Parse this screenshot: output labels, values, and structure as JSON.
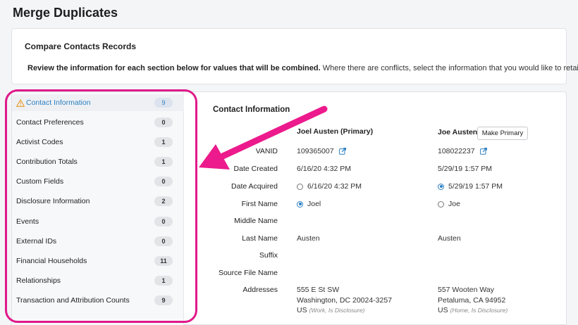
{
  "page": {
    "title": "Merge Duplicates"
  },
  "compare": {
    "title": "Compare Contacts Records",
    "desc_bold": "Review the information for each section below for values that will be combined.",
    "desc_rest": " Where there are conflicts, select the information that you would like to retain."
  },
  "sidebar": {
    "items": [
      {
        "label": "Contact Information",
        "count": "9"
      },
      {
        "label": "Contact Preferences",
        "count": "0"
      },
      {
        "label": "Activist Codes",
        "count": "1"
      },
      {
        "label": "Contribution Totals",
        "count": "1"
      },
      {
        "label": "Custom Fields",
        "count": "0"
      },
      {
        "label": "Disclosure Information",
        "count": "2"
      },
      {
        "label": "Events",
        "count": "0"
      },
      {
        "label": "External IDs",
        "count": "0"
      },
      {
        "label": "Financial Households",
        "count": "11"
      },
      {
        "label": "Relationships",
        "count": "1"
      },
      {
        "label": "Transaction and Attribution Counts",
        "count": "9"
      }
    ],
    "active_icon": "warning-triangle-icon"
  },
  "section": {
    "title": "Contact Information",
    "primary_name": "Joel Austen (Primary)",
    "secondary_name": "Joe Austen",
    "make_primary_label": "Make Primary"
  },
  "fields": {
    "vanid": {
      "label": "VANID",
      "primary": "109365007",
      "secondary": "108022237"
    },
    "date_created": {
      "label": "Date Created",
      "primary": "6/16/20 4:32 PM",
      "secondary": "5/29/19 1:57 PM"
    },
    "date_acquired": {
      "label": "Date Acquired",
      "primary": "6/16/20 4:32 PM",
      "secondary": "5/29/19 1:57 PM",
      "selected": "secondary"
    },
    "first_name": {
      "label": "First Name",
      "primary": "Joel",
      "secondary": "Joe",
      "selected": "primary"
    },
    "middle_name": {
      "label": "Middle Name"
    },
    "last_name": {
      "label": "Last Name",
      "primary": "Austen",
      "secondary": "Austen"
    },
    "suffix": {
      "label": "Suffix"
    },
    "source_file_name": {
      "label": "Source File Name"
    },
    "addresses": {
      "label": "Addresses",
      "primary": {
        "line1": "555 E St SW",
        "line2": "Washington, DC 20024-3257",
        "country": "US",
        "note": "(Work, Is Disclosure)"
      },
      "secondary": {
        "line1": "557 Wooten Way",
        "line2": "Petaluma, CA 94952",
        "country": "US",
        "note": "(Home, Is Disclosure)"
      }
    }
  },
  "colors": {
    "accent": "#2c7fc1",
    "highlight": "#e0198a",
    "warning": "#e8a33d"
  }
}
